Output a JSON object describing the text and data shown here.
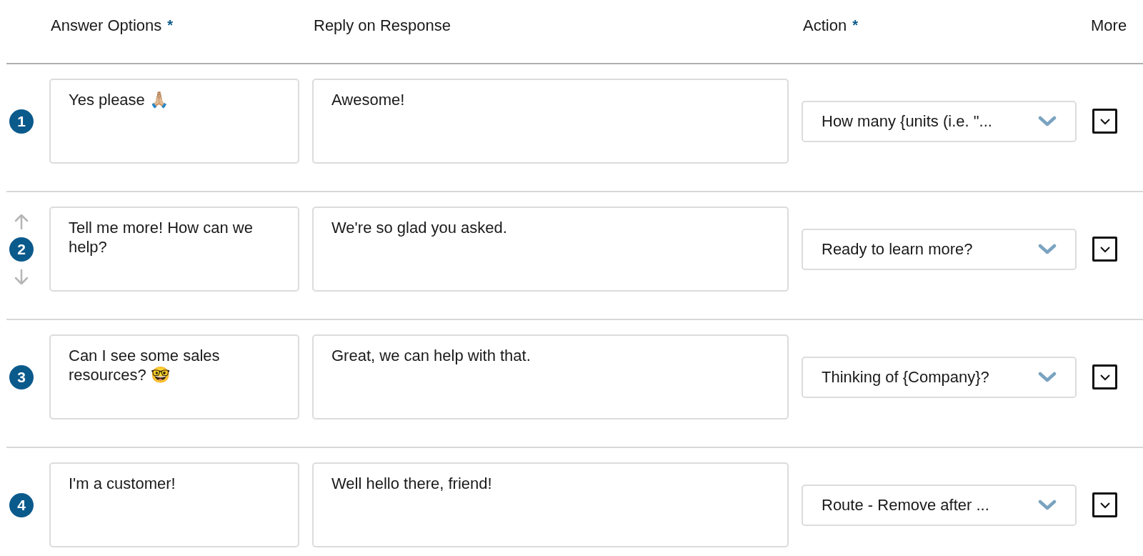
{
  "columns": [
    {
      "label": "Answer Options",
      "required": true
    },
    {
      "label": "Reply on Response",
      "required": false
    },
    {
      "label": "Action",
      "required": true
    },
    {
      "label": "More",
      "required": false
    }
  ],
  "required_mark": "*",
  "rows": [
    {
      "number": "1",
      "answer": "Yes please 🙏🏼",
      "reply": "Awesome!",
      "action": "How many {units (i.e. \"...",
      "reorder_controls": false
    },
    {
      "number": "2",
      "answer": "Tell me more! How can we help?",
      "reply": "We're so glad you asked.",
      "action": "Ready to learn more?",
      "reorder_controls": true
    },
    {
      "number": "3",
      "answer": "Can I see some sales resources? 🤓",
      "reply": "Great, we can help with that.",
      "action": "Thinking of {Company}?",
      "reorder_controls": false
    },
    {
      "number": "4",
      "answer": "I'm a customer!",
      "reply": "Well hello there, friend!",
      "action": "Route - Remove after ...",
      "reorder_controls": false
    }
  ]
}
